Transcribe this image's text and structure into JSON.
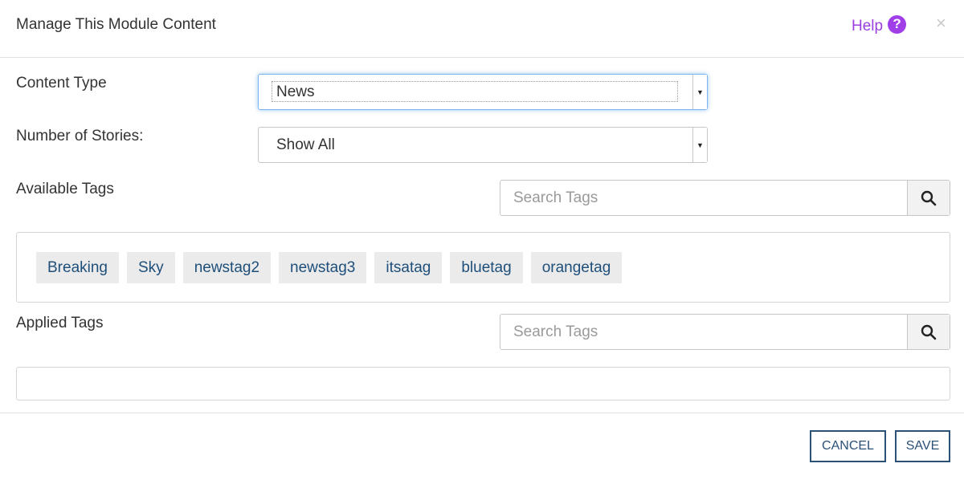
{
  "header": {
    "title": "Manage This Module Content",
    "help_label": "Help",
    "help_icon": "question-circle-icon",
    "close_symbol": "×"
  },
  "content_type": {
    "label": "Content Type",
    "value": "News"
  },
  "stories": {
    "label": "Number of Stories:",
    "value": "Show All"
  },
  "available": {
    "label": "Available Tags",
    "search_placeholder": "Search Tags",
    "tags": [
      "Breaking",
      "Sky",
      "newstag2",
      "newstag3",
      "itsatag",
      "bluetag",
      "orangetag"
    ]
  },
  "applied": {
    "label": "Applied Tags",
    "search_placeholder": "Search Tags",
    "tags": []
  },
  "footer": {
    "cancel_label": "CANCEL",
    "save_label": "SAVE"
  },
  "colors": {
    "accent_purple": "#9b3fe0",
    "button_navy": "#2c5177",
    "tag_text": "#1e4f7a"
  }
}
